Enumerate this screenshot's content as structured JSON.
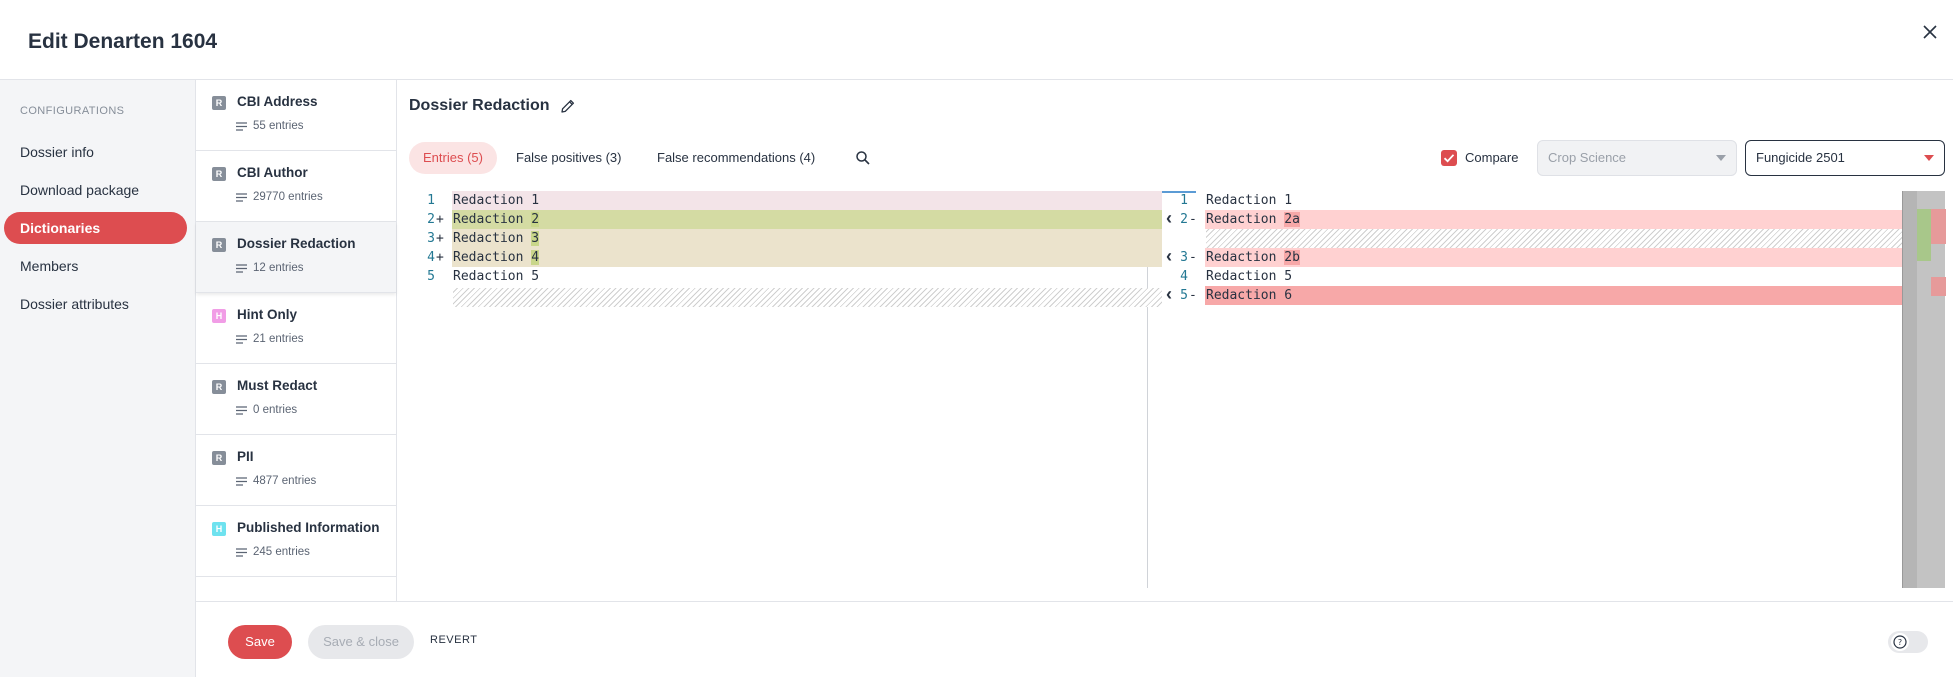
{
  "dialog": {
    "title": "Edit Denarten 1604"
  },
  "nav": {
    "section_label": "CONFIGURATIONS",
    "items": [
      {
        "label": "Dossier info",
        "active": false
      },
      {
        "label": "Download package",
        "active": false
      },
      {
        "label": "Dictionaries",
        "active": true
      },
      {
        "label": "Members",
        "active": false
      },
      {
        "label": "Dossier attributes",
        "active": false
      }
    ]
  },
  "dictionaries": [
    {
      "badge": "R",
      "badge_color": "#868e99",
      "name": "CBI Address",
      "count": "55 entries"
    },
    {
      "badge": "R",
      "badge_color": "#868e99",
      "name": "CBI Author",
      "count": "29770 entries"
    },
    {
      "badge": "R",
      "badge_color": "#868e99",
      "name": "Dossier Redaction",
      "count": "12 entries"
    },
    {
      "badge": "H",
      "badge_color": "#f19de6",
      "name": "Hint Only",
      "count": "21 entries"
    },
    {
      "badge": "R",
      "badge_color": "#868e99",
      "name": "Must Redact",
      "count": "0 entries"
    },
    {
      "badge": "R",
      "badge_color": "#868e99",
      "name": "PII",
      "count": "4877 entries"
    },
    {
      "badge": "H",
      "badge_color": "#6ee2ef",
      "name": "Published Information",
      "count": "245 entries"
    }
  ],
  "main": {
    "title": "Dossier Redaction",
    "tabs": [
      {
        "label": "Entries (5)",
        "active": true
      },
      {
        "label": "False positives (3)",
        "active": false
      },
      {
        "label": "False recommendations (4)",
        "active": false
      }
    ],
    "compare_label": "Compare",
    "compare_checked": true,
    "select_disabled": "Crop Science",
    "select_enabled": "Fungicide 2501"
  },
  "diff": {
    "left": [
      {
        "num": "1",
        "sign": "",
        "prefix": "Redaction ",
        "suffix": "1"
      },
      {
        "num": "2",
        "sign": "+",
        "prefix": "Redaction ",
        "suffix": "2"
      },
      {
        "num": "3",
        "sign": "+",
        "prefix": "Redaction ",
        "suffix": "3"
      },
      {
        "num": "4",
        "sign": "+",
        "prefix": "Redaction ",
        "suffix": "4"
      },
      {
        "num": "5",
        "sign": "",
        "prefix": "Redaction ",
        "suffix": "5"
      }
    ],
    "right": [
      {
        "num": "1",
        "sign": "",
        "prefix": "Redaction ",
        "suffix": "1"
      },
      {
        "num": "2",
        "sign": "-",
        "prefix": "Redaction ",
        "suffix": "2a"
      },
      {
        "num": "3",
        "sign": "-",
        "prefix": "Redaction ",
        "suffix": "2b"
      },
      {
        "num": "4",
        "sign": "",
        "prefix": "Redaction ",
        "suffix": "5"
      },
      {
        "num": "5",
        "sign": "-",
        "prefix": "Redaction ",
        "suffix": "6"
      }
    ]
  },
  "footer": {
    "save_label": "Save",
    "save_close_label": "Save & close",
    "revert_label": "REVERT"
  },
  "colors": {
    "accent": "#dd4d50",
    "added_line": "#d4dba3",
    "added_highlight": "#c9d68a",
    "modified_line": "#ebe3cc",
    "removed_line": "#ffd1d1",
    "removed_strong": "#f7a8a8"
  }
}
